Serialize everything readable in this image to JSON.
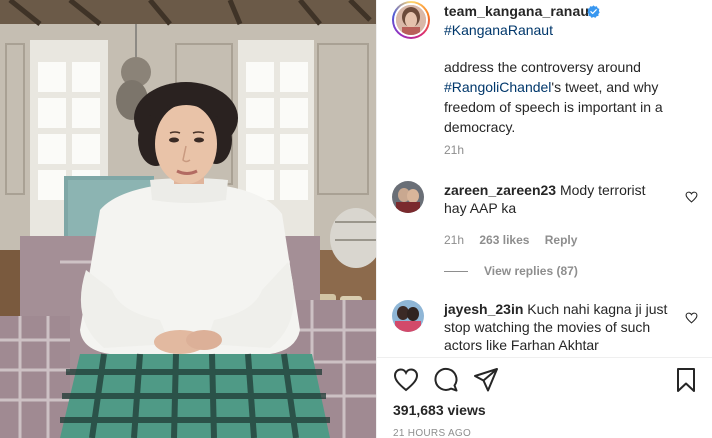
{
  "post": {
    "author": "team_kangana_ranaut",
    "author_hashtag": "#KanganaRanaut",
    "verified_badge": "verified-badge-icon",
    "caption_part1": "address the controversy around ",
    "caption_tag": "#RangoliChandel",
    "caption_part2": "'s tweet, and why freedom of speech is important in a democracy.",
    "caption_time": "21h"
  },
  "comments": [
    {
      "user": "zareen_zareen23",
      "text": "Mody terrorist hay AAP ka",
      "time": "21h",
      "likes": "263 likes",
      "reply_label": "Reply",
      "view_replies": "View replies (87)"
    },
    {
      "user": "jayesh_23in",
      "text": "Kuch nahi kagna ji just stop watching the movies of such actors like Farhan Akhtar"
    }
  ],
  "actions": {
    "like_icon": "heart-icon",
    "comment_icon": "comment-icon",
    "share_icon": "send-icon",
    "save_icon": "bookmark-icon",
    "views": "391,683 views",
    "posted_ago": "21 HOURS AGO"
  },
  "colors": {
    "link": "#00376b",
    "muted": "#8e8e8e",
    "text": "#262626",
    "verified": "#3897f0"
  }
}
